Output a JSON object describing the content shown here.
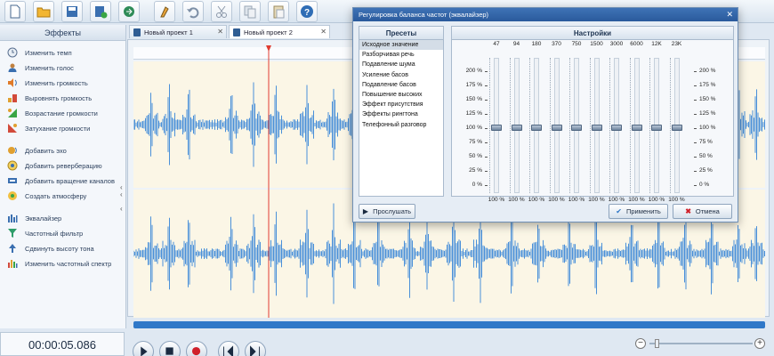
{
  "toolbar": {
    "buttons": [
      {
        "name": "new-file-icon"
      },
      {
        "name": "open-folder-icon"
      },
      {
        "name": "save-icon"
      },
      {
        "name": "add-file-icon"
      },
      {
        "name": "export-icon"
      },
      {
        "name": "record-icon"
      },
      {
        "name": "undo-icon"
      },
      {
        "name": "cut-icon"
      },
      {
        "name": "copy-icon"
      },
      {
        "name": "paste-icon"
      },
      {
        "name": "help-icon"
      }
    ]
  },
  "left_panel": {
    "header": "Эффекты",
    "groups": [
      [
        {
          "label": "Изменить темп",
          "icon": "clock-icon"
        },
        {
          "label": "Изменить голос",
          "icon": "person-icon"
        },
        {
          "label": "Изменить громкость",
          "icon": "volume-icon"
        },
        {
          "label": "Выровнять громкость",
          "icon": "level-icon"
        },
        {
          "label": "Возрастание громкости",
          "icon": "fade-in-icon"
        },
        {
          "label": "Затухание громкости",
          "icon": "fade-out-icon"
        }
      ],
      [
        {
          "label": "Добавить эхо",
          "icon": "echo-icon"
        },
        {
          "label": "Добавить реверберацию",
          "icon": "reverb-icon"
        },
        {
          "label": "Добавить вращение каналов",
          "icon": "rotate-icon"
        },
        {
          "label": "Создать атмосферу",
          "icon": "atmosphere-icon"
        }
      ],
      [
        {
          "label": "Эквалайзер",
          "icon": "equalizer-icon"
        },
        {
          "label": "Частотный фильтр",
          "icon": "filter-icon"
        },
        {
          "label": "Сдвинуть высоту тона",
          "icon": "pitch-icon"
        },
        {
          "label": "Изменить частотный спектр",
          "icon": "spectrum-icon"
        }
      ]
    ]
  },
  "tabs": [
    {
      "label": "Новый проект 1",
      "active": false
    },
    {
      "label": "Новый проект 2",
      "active": true
    }
  ],
  "timer": "00:00:05.086",
  "dialog": {
    "title": "Регулировка баланса частот (эквалайзер)",
    "presets_header": "Пресеты",
    "settings_header": "Настройки",
    "presets": [
      "Исходное значение",
      "Разборчивая речь",
      "Подавление шума",
      "Усиление басов",
      "Подавление басов",
      "Повышение высоких",
      "Эффект присутствия",
      "Эффекты рингтона",
      "Телефонный разговор"
    ],
    "selected_preset": 0,
    "bands": [
      {
        "freq": "47",
        "value": "100 %",
        "level": 100
      },
      {
        "freq": "94",
        "value": "100 %",
        "level": 100
      },
      {
        "freq": "180",
        "value": "100 %",
        "level": 100
      },
      {
        "freq": "370",
        "value": "100 %",
        "level": 100
      },
      {
        "freq": "750",
        "value": "100 %",
        "level": 100
      },
      {
        "freq": "1500",
        "value": "100 %",
        "level": 100
      },
      {
        "freq": "3000",
        "value": "100 %",
        "level": 100
      },
      {
        "freq": "6000",
        "value": "100 %",
        "level": 100
      },
      {
        "freq": "12K",
        "value": "100 %",
        "level": 100
      },
      {
        "freq": "23K",
        "value": "100 %",
        "level": 100
      }
    ],
    "levels": [
      "200 %",
      "175 %",
      "150 %",
      "125 %",
      "100 %",
      "75 %",
      "50 %",
      "25 %",
      "0 %"
    ],
    "listen_label": "Прослушать",
    "apply_label": "Применить",
    "cancel_label": "Отмена"
  },
  "colors": {
    "waveform": "#4a90d9",
    "playhead": "#e03c31",
    "track_bg": "#fbf6e6",
    "scrollbar": "#2f78c8"
  }
}
